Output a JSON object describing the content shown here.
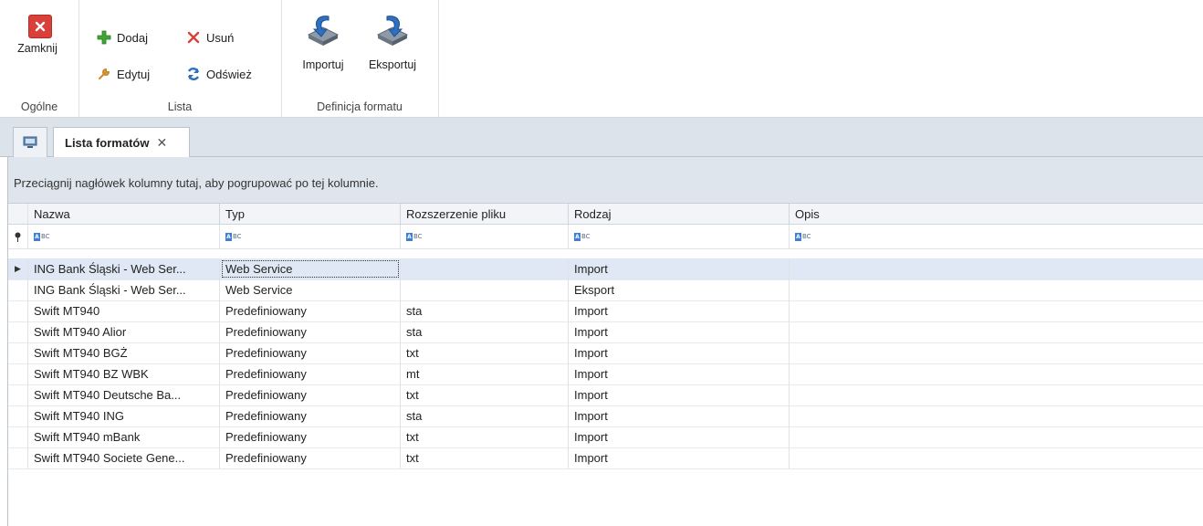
{
  "ribbon": {
    "groups": {
      "ogolne": {
        "label": "Ogólne",
        "close_label": "Zamknij"
      },
      "lista": {
        "label": "Lista",
        "add_label": "Dodaj",
        "delete_label": "Usuń",
        "edit_label": "Edytuj",
        "refresh_label": "Odśwież"
      },
      "definicja": {
        "label": "Definicja formatu",
        "import_label": "Importuj",
        "export_label": "Eksportuj"
      }
    }
  },
  "tabs": {
    "active_label": "Lista formatów",
    "close_glyph": "✕"
  },
  "grid": {
    "group_panel_text": "Przeciągnij nagłówek kolumny tutaj, aby pogrupować po tej kolumnie.",
    "columns": [
      "Nazwa",
      "Typ",
      "Rozszerzenie pliku",
      "Rodzaj",
      "Opis"
    ],
    "filter_glyph": "BC",
    "rows": [
      {
        "nazwa": "ING Bank Śląski - Web Ser...",
        "typ": "Web Service",
        "rozszerzenie": "",
        "rodzaj": "Import",
        "opis": ""
      },
      {
        "nazwa": "ING Bank Śląski - Web Ser...",
        "typ": "Web Service",
        "rozszerzenie": "",
        "rodzaj": "Eksport",
        "opis": ""
      },
      {
        "nazwa": "Swift MT940",
        "typ": "Predefiniowany",
        "rozszerzenie": "sta",
        "rodzaj": "Import",
        "opis": ""
      },
      {
        "nazwa": "Swift MT940 Alior",
        "typ": "Predefiniowany",
        "rozszerzenie": "sta",
        "rodzaj": "Import",
        "opis": ""
      },
      {
        "nazwa": "Swift MT940 BGŻ",
        "typ": "Predefiniowany",
        "rozszerzenie": "txt",
        "rodzaj": "Import",
        "opis": ""
      },
      {
        "nazwa": "Swift MT940 BZ WBK",
        "typ": "Predefiniowany",
        "rozszerzenie": "mt",
        "rodzaj": "Import",
        "opis": ""
      },
      {
        "nazwa": "Swift MT940 Deutsche Ba...",
        "typ": "Predefiniowany",
        "rozszerzenie": "txt",
        "rodzaj": "Import",
        "opis": ""
      },
      {
        "nazwa": "Swift MT940 ING",
        "typ": "Predefiniowany",
        "rozszerzenie": "sta",
        "rodzaj": "Import",
        "opis": ""
      },
      {
        "nazwa": "Swift MT940 mBank",
        "typ": "Predefiniowany",
        "rozszerzenie": "txt",
        "rodzaj": "Import",
        "opis": ""
      },
      {
        "nazwa": "Swift MT940 Societe Gene...",
        "typ": "Predefiniowany",
        "rozszerzenie": "txt",
        "rodzaj": "Import",
        "opis": ""
      }
    ]
  },
  "colors": {
    "accent": "#3d7fd0",
    "selected_row": "#dfe8f4",
    "close_red": "#d9403a",
    "add_green": "#3fa535"
  },
  "icons": {
    "close": "close-window-icon",
    "add": "plus-icon",
    "delete": "x-icon",
    "edit": "wrench-icon",
    "refresh": "refresh-icon",
    "import": "import-icon",
    "export": "export-icon",
    "home": "desktop-icon"
  }
}
